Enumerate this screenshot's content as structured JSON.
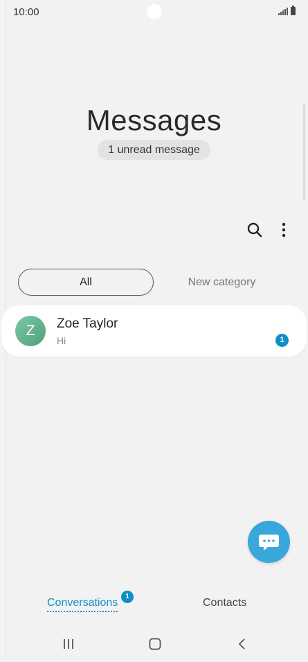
{
  "status_bar": {
    "time": "10:00"
  },
  "header": {
    "title": "Messages",
    "unread_label": "1 unread message"
  },
  "toolbar": {
    "search_icon": "search-icon",
    "more_icon": "more-vertical-icon"
  },
  "categories": [
    {
      "label": "All",
      "selected": true
    },
    {
      "label": "New category",
      "selected": false
    }
  ],
  "conversations": [
    {
      "avatar_letter": "Z",
      "name": "Zoe Taylor",
      "preview": "Hi",
      "unread_count": "1",
      "avatar_color": "#5fb38e"
    }
  ],
  "fab": {
    "icon": "chat-bubble-icon",
    "color": "#3aa7dc"
  },
  "bottom_tabs": [
    {
      "label": "Conversations",
      "active": true,
      "badge": "1"
    },
    {
      "label": "Contacts",
      "active": false
    }
  ],
  "accent_color": "#0e8fc8"
}
